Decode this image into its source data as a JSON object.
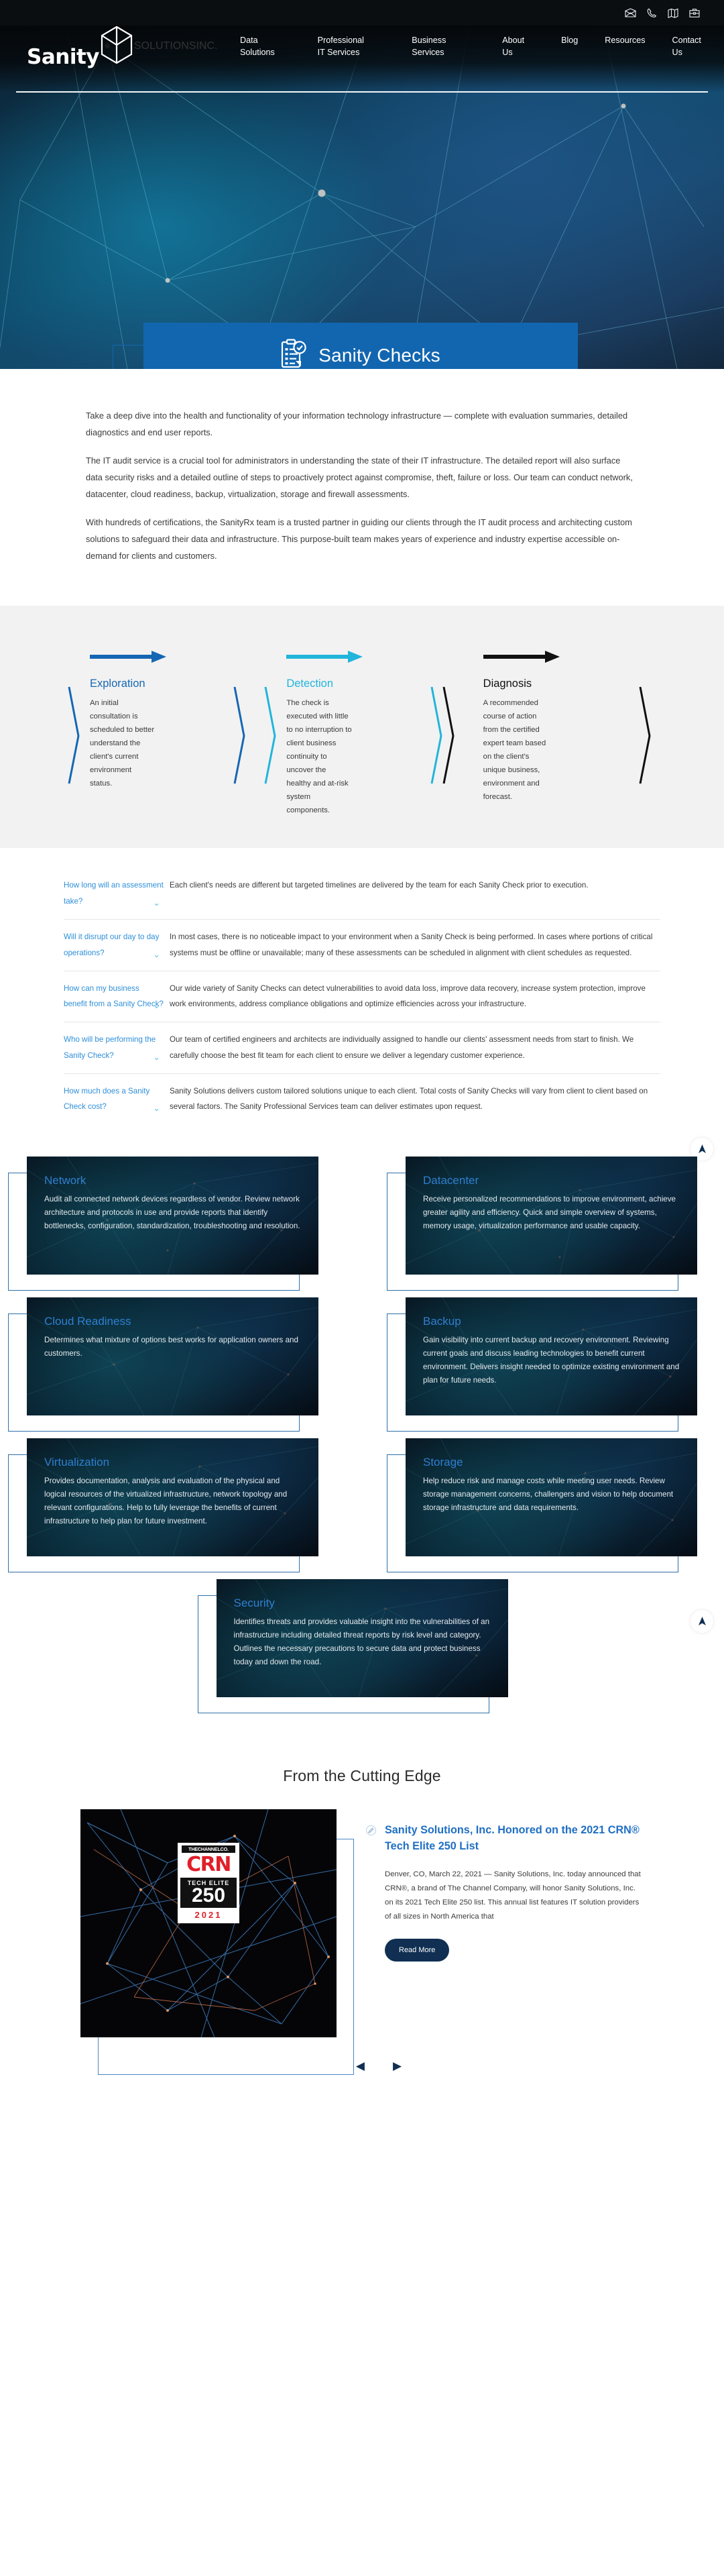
{
  "topbar": {
    "icons": [
      {
        "name": "mail-icon",
        "label": "Email"
      },
      {
        "name": "phone-icon",
        "label": "Phone"
      },
      {
        "name": "map-icon",
        "label": "Map"
      },
      {
        "name": "briefcase-icon",
        "label": "Careers"
      }
    ]
  },
  "brand": {
    "word": "Sanity",
    "sub": "SOLUTIONS",
    "inc": "INC."
  },
  "nav": {
    "items": [
      {
        "label": "Data Solutions"
      },
      {
        "label": "Professional IT Services"
      },
      {
        "label": "Business Services"
      },
      {
        "label": "About Us"
      },
      {
        "label": "Blog"
      },
      {
        "label": "Resources"
      },
      {
        "label": "Contact Us"
      }
    ]
  },
  "hero": {
    "banner_title": "Sanity Checks",
    "banner_icon": "clipboard-check-icon",
    "banner_color": "#1266b0"
  },
  "intro": {
    "paragraphs": [
      "Take a deep dive into the health and functionality of your information technology infrastructure — complete with evaluation summaries, detailed diagnostics and end user reports.",
      "The IT audit service is a crucial tool for administrators in understanding the state of their IT infrastructure. The detailed report will also surface data security risks and a detailed outline of steps to proactively protect against compromise, theft, failure or loss. Our team can conduct network, datacenter, cloud readiness, backup, virtualization, storage and firewall assessments.",
      "With hundreds of certifications, the SanityRx team is a trusted partner in guiding our clients through the IT audit process and architecting custom solutions to safeguard their data and infrastructure. This purpose-built team makes years of experience and industry expertise accessible on-demand for clients and customers."
    ]
  },
  "process": {
    "steps": [
      {
        "title": "Exploration",
        "color": "#1667b3",
        "body": "An initial consultation is scheduled to better understand the client's current environment status."
      },
      {
        "title": "Detection",
        "color": "#21b5db",
        "body": "The check is executed with little to no interruption to client business continuity to uncover the healthy and at-risk system components."
      },
      {
        "title": "Diagnosis",
        "color": "#111111",
        "body": "A recommended course of action from the certified expert team based on the client's unique business, environment and forecast."
      }
    ]
  },
  "faq": {
    "items": [
      {
        "question": "How long will an assessment take?",
        "answer": "Each client's needs are different but targeted timelines are delivered by the team for each Sanity Check prior to execution."
      },
      {
        "question": "Will it disrupt our day to day operations?",
        "answer": "In most cases, there is no noticeable impact to your environment when a Sanity Check is being performed. In cases where portions of critical systems must be offline or unavailable; many of these assessments can be scheduled in alignment with client schedules as requested."
      },
      {
        "question": "How can my business benefit from a Sanity Check?",
        "answer": "Our wide variety of Sanity Checks can detect vulnerabilities to avoid data loss, improve data recovery, increase system protection, improve work environments, address compliance obligations and optimize efficiencies across your infrastructure."
      },
      {
        "question": "Who will be performing the Sanity Check?",
        "answer": "Our team of certified engineers and architects are individually assigned to handle our clients' assessment needs from start to finish. We carefully choose the best fit team for each client to ensure we deliver a legendary customer experience."
      },
      {
        "question": "How much does a Sanity Check cost?",
        "answer": "Sanity Solutions delivers custom tailored solutions unique to each client. Total costs of Sanity Checks will vary from client to client based on several factors. The Sanity Professional Services team can deliver estimates upon request."
      }
    ]
  },
  "services": {
    "cards": [
      {
        "title": "Network",
        "body": "Audit all connected network devices regardless of vendor. Review network architecture and protocols in use and provide reports that identify bottlenecks, configuration, standardization, troubleshooting and resolution."
      },
      {
        "title": "Datacenter",
        "body": "Receive personalized recommendations to improve environment, achieve greater agility and efficiency. Quick and simple overview of systems, memory usage, virtualization performance and usable capacity."
      },
      {
        "title": "Cloud Readiness",
        "body": "Determines what mixture of options best works for application owners and customers."
      },
      {
        "title": "Backup",
        "body": "Gain visibility into current backup and recovery environment. Reviewing current goals and discuss leading technologies to benefit current environment. Delivers insight needed to optimize existing environment and plan for future needs."
      },
      {
        "title": "Virtualization",
        "body": "Provides documentation, analysis and evaluation of the physical and logical resources of the virtualized infrastructure, network topology and relevant configurations. Help to fully leverage the benefits of current infrastructure to help plan for future investment."
      },
      {
        "title": "Storage",
        "body": "Help reduce risk and manage costs while meeting user needs. Review storage management concerns, challengers and vision to help document storage infrastructure and data requirements."
      },
      {
        "title": "Security",
        "body": "Identifies threats and provides valuable insight into the vulnerabilities of an infrastructure including detailed threat reports by risk level and category. Outlines the necessary precautions to secure data and protect business today and down the road."
      }
    ]
  },
  "news": {
    "heading": "From the Cutting Edge",
    "article": {
      "title": "Sanity Solutions, Inc. Honored on the 2021 CRN® Tech Elite 250 List",
      "excerpt": "Denver, CO, March 22, 2021 — Sanity Solutions, Inc. today announced that CRN®, a brand of The Channel Company, will honor Sanity Solutions, Inc. on its 2021 Tech Elite 250 list. This annual list features IT solution providers of all sizes in North America that",
      "button": "Read More"
    },
    "badge": {
      "channel": "THECHANNELCO.",
      "crn": "CRN",
      "tech_elite": "TECH ELITE",
      "number": "250",
      "year": "2021"
    },
    "prev_label": "◀",
    "next_label": "▶"
  },
  "scroll_top": {
    "label": "scroll-to-top"
  }
}
